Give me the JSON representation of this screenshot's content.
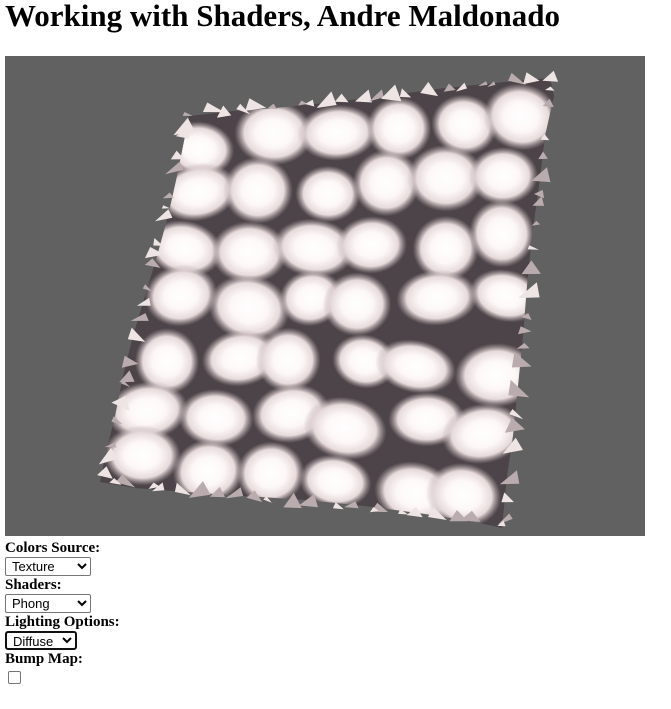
{
  "page": {
    "title": "Working with Shaders, Andre Maldonado"
  },
  "canvas": {
    "background_color": "#616161",
    "surface_color": "#f4ecea",
    "shadow_color": "#4c4448"
  },
  "controls": {
    "colors_source": {
      "label": "Colors Source:",
      "selected": "Texture"
    },
    "shaders": {
      "label": "Shaders:",
      "selected": "Phong"
    },
    "lighting_options": {
      "label": "Lighting Options:",
      "selected": "Diffuse"
    },
    "bump_map": {
      "label": "Bump Map:",
      "checked": false
    }
  }
}
